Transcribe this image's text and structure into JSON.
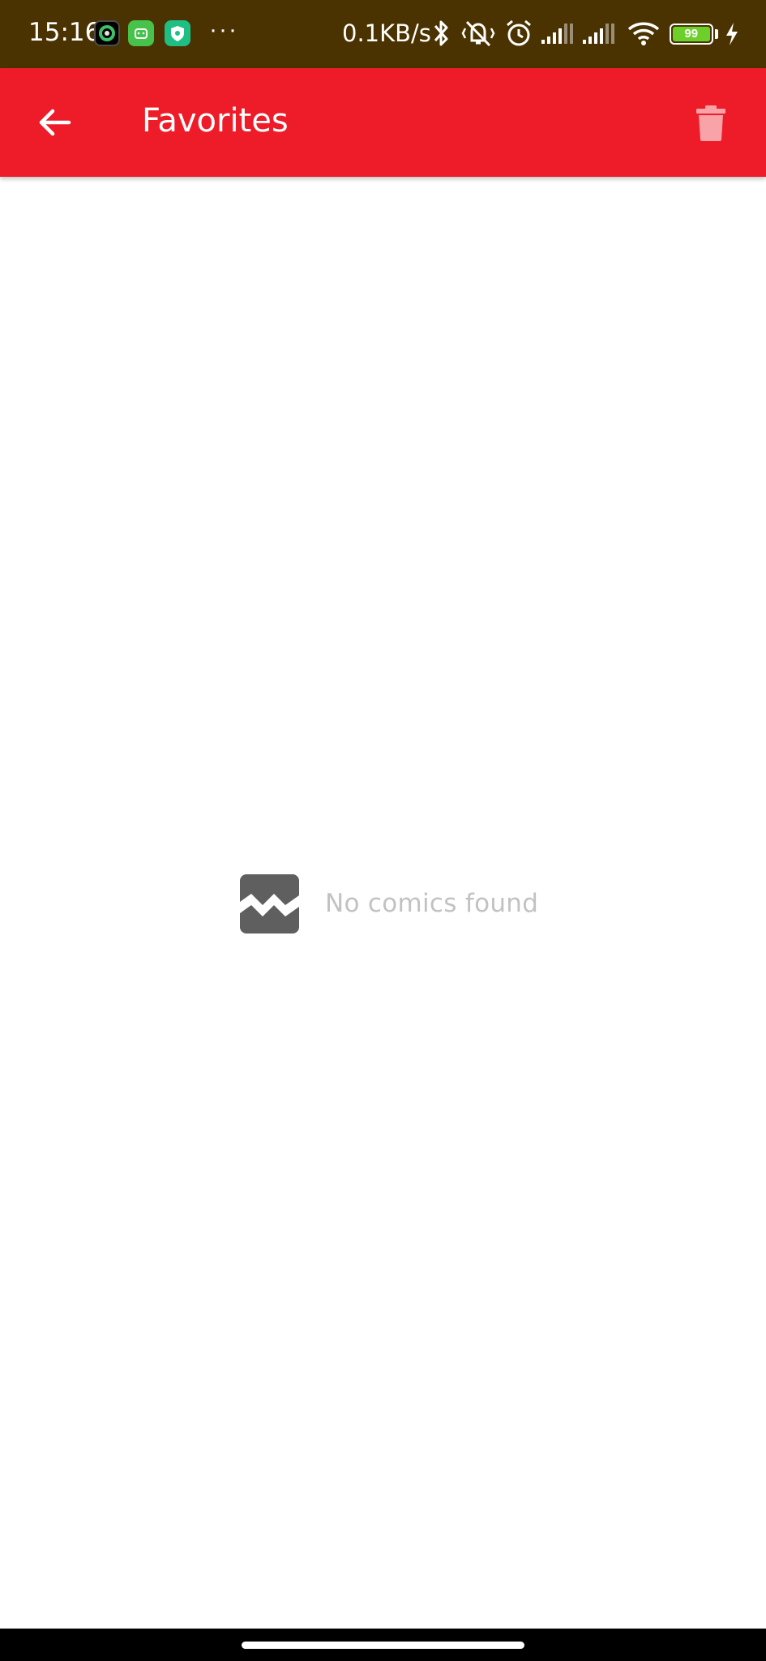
{
  "status_bar": {
    "time": "15:16",
    "more": "···",
    "network_speed": "0.1KB/s",
    "battery_level": "99",
    "icons": [
      "bluetooth-icon",
      "vibrate-silent-icon",
      "alarm-icon",
      "signal-icon",
      "signal-icon",
      "wifi-icon",
      "charging-icon"
    ]
  },
  "app_bar": {
    "title": "Favorites",
    "background_color": "#ee1c28",
    "back_icon": "arrow-back-icon",
    "action_icon": "trash-icon"
  },
  "empty_state": {
    "message": "No comics found",
    "icon": "broken-image-icon"
  }
}
